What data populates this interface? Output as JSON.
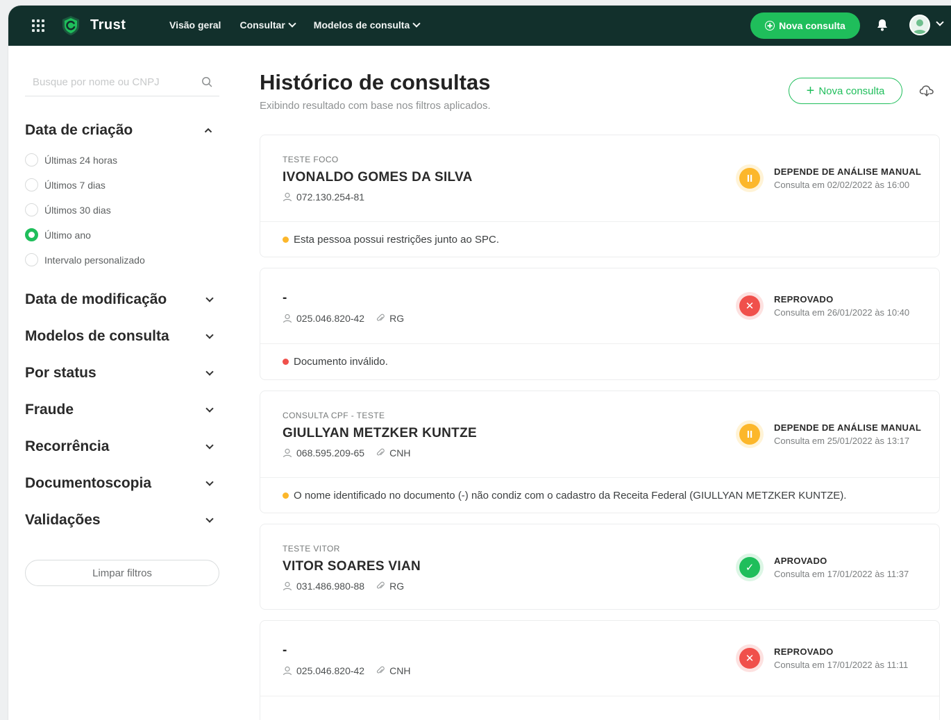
{
  "app": {
    "brand": "Trust"
  },
  "nav": {
    "overview": "Visão geral",
    "consult": "Consultar",
    "models": "Modelos de consulta"
  },
  "topbar": {
    "new_consult": "Nova consulta"
  },
  "sidebar": {
    "search_placeholder": "Busque por nome ou CNPJ",
    "creation": {
      "title": "Data de criação",
      "options": [
        "Últimas 24 horas",
        "Últimos 7 dias",
        "Últimos 30 dias",
        "Último ano",
        "Intervalo personalizado"
      ],
      "selected": "Último ano"
    },
    "sections": [
      "Data de modificação",
      "Modelos de consulta",
      "Por status",
      "Fraude",
      "Recorrência",
      "Documentoscopia",
      "Validações"
    ],
    "clear": "Limpar filtros"
  },
  "main": {
    "title": "Histórico de consultas",
    "subtitle": "Exibindo resultado com base nos filtros aplicados.",
    "new_consult": "Nova consulta",
    "cards": [
      {
        "kicker": "TESTE FOCO",
        "name": "IVONALDO GOMES DA SILVA",
        "doc": "072.130.254-81",
        "doc_type": "",
        "status": "DEPENDE DE ANÁLISE MANUAL",
        "date": "Consulta em 02/02/2022 às 16:00",
        "note": "Esta pessoa possui restrições junto ao SPC."
      },
      {
        "kicker": "",
        "name": "-",
        "doc": "025.046.820-42",
        "doc_type": "RG",
        "status": "REPROVADO",
        "date": "Consulta em 26/01/2022 às 10:40",
        "note": "Documento inválido."
      },
      {
        "kicker": "CONSULTA CPF - TESTE",
        "name": "GIULLYAN METZKER KUNTZE",
        "doc": "068.595.209-65",
        "doc_type": "CNH",
        "status": "DEPENDE DE ANÁLISE MANUAL",
        "date": "Consulta em 25/01/2022 às 13:17",
        "note": "O nome identificado no documento (-) não condiz com o cadastro da Receita Federal (GIULLYAN METZKER KUNTZE)."
      },
      {
        "kicker": "TESTE VITOR",
        "name": "VITOR SOARES VIAN",
        "doc": "031.486.980-88",
        "doc_type": "RG",
        "status": "APROVADO",
        "date": "Consulta em 17/01/2022 às 11:37"
      },
      {
        "kicker": "",
        "name": "-",
        "doc": "025.046.820-42",
        "doc_type": "CNH",
        "status": "REPROVADO",
        "date": "Consulta em 17/01/2022 às 11:11"
      }
    ]
  },
  "colors": {
    "brand": "#12302c",
    "accent": "#1fbe5b",
    "warning": "#fcb72b",
    "danger": "#f0504b"
  },
  "icons": [
    "apps-icon",
    "shield-logo-icon",
    "bell-icon",
    "search-icon",
    "chevron-down-icon",
    "chevron-up-icon",
    "cloud-download-icon",
    "user-icon",
    "paperclip-icon",
    "pause-icon",
    "close-icon",
    "check-icon"
  ]
}
